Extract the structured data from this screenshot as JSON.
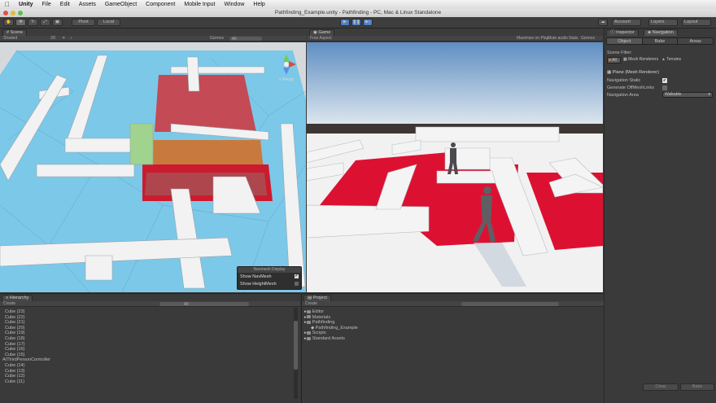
{
  "menubar": {
    "apple": "",
    "items": [
      "Unity",
      "File",
      "Edit",
      "Assets",
      "GameObject",
      "Component",
      "Mobile Input",
      "Window",
      "Help"
    ]
  },
  "window_title": "Pathfinding_Example.unity - Pathfinding - PC, Mac & Linux Standalone",
  "toolbar": {
    "pivot": "Pivot",
    "local": "Local",
    "account": "Account",
    "layers": "Layers",
    "layout": "Layout"
  },
  "scene": {
    "tab": "Scene",
    "shading": "Shaded",
    "mode_2d": "2D",
    "gizmos": "Gizmos",
    "search_placeholder": "All",
    "persp_label": "< Persp",
    "navmesh_display": {
      "title": "Navmesh Display",
      "show_navmesh": "Show NavMesh",
      "show_heightmesh": "Show HeightMesh"
    }
  },
  "game": {
    "tab": "Game",
    "aspect": "Free Aspect",
    "maximize": "Maximize on Play",
    "mute": "Mute audio",
    "stats": "Stats",
    "gizmos": "Gizmos"
  },
  "inspector": {
    "tab": "Inspector",
    "nav_tab": "Navigation",
    "subtabs": [
      "Object",
      "Bake",
      "Areas"
    ],
    "scene_filter_label": "Scene Filter:",
    "filters": [
      "All",
      "Mesh Renderers",
      "Terrains"
    ],
    "object_name": "Plane (Mesh Renderer)",
    "fields": [
      {
        "label": "Navigation Static",
        "value": "✔"
      },
      {
        "label": "Generate OffMeshLinks",
        "value": ""
      },
      {
        "label": "Navigation Area",
        "value": "Walkable"
      }
    ],
    "buttons": {
      "clear": "Clear",
      "bake": "Bake"
    }
  },
  "hierarchy": {
    "tab": "Hierarchy",
    "create": "Create",
    "search": "All",
    "items": [
      "Cube (23)",
      "Cube (22)",
      "Cube (21)",
      "Cube (20)",
      "Cube (19)",
      "Cube (18)",
      "Cube (17)",
      "Cube (16)",
      "Cube (15)",
      "AIThirdPersonController",
      "Cube (14)",
      "Cube (13)",
      "Cube (12)",
      "Cube (11)"
    ]
  },
  "project": {
    "tab": "Project",
    "create": "Create",
    "items": [
      "Editor",
      "Materials",
      "Pathfinding",
      "Pathfinding_Example",
      "Scripts",
      "Standard Assets"
    ]
  },
  "colors": {
    "nav_blue": "#7cc8e8",
    "red_area": "#d8102c",
    "sky_top": "#5f8ec2",
    "sky_bottom": "#e8eef2"
  }
}
